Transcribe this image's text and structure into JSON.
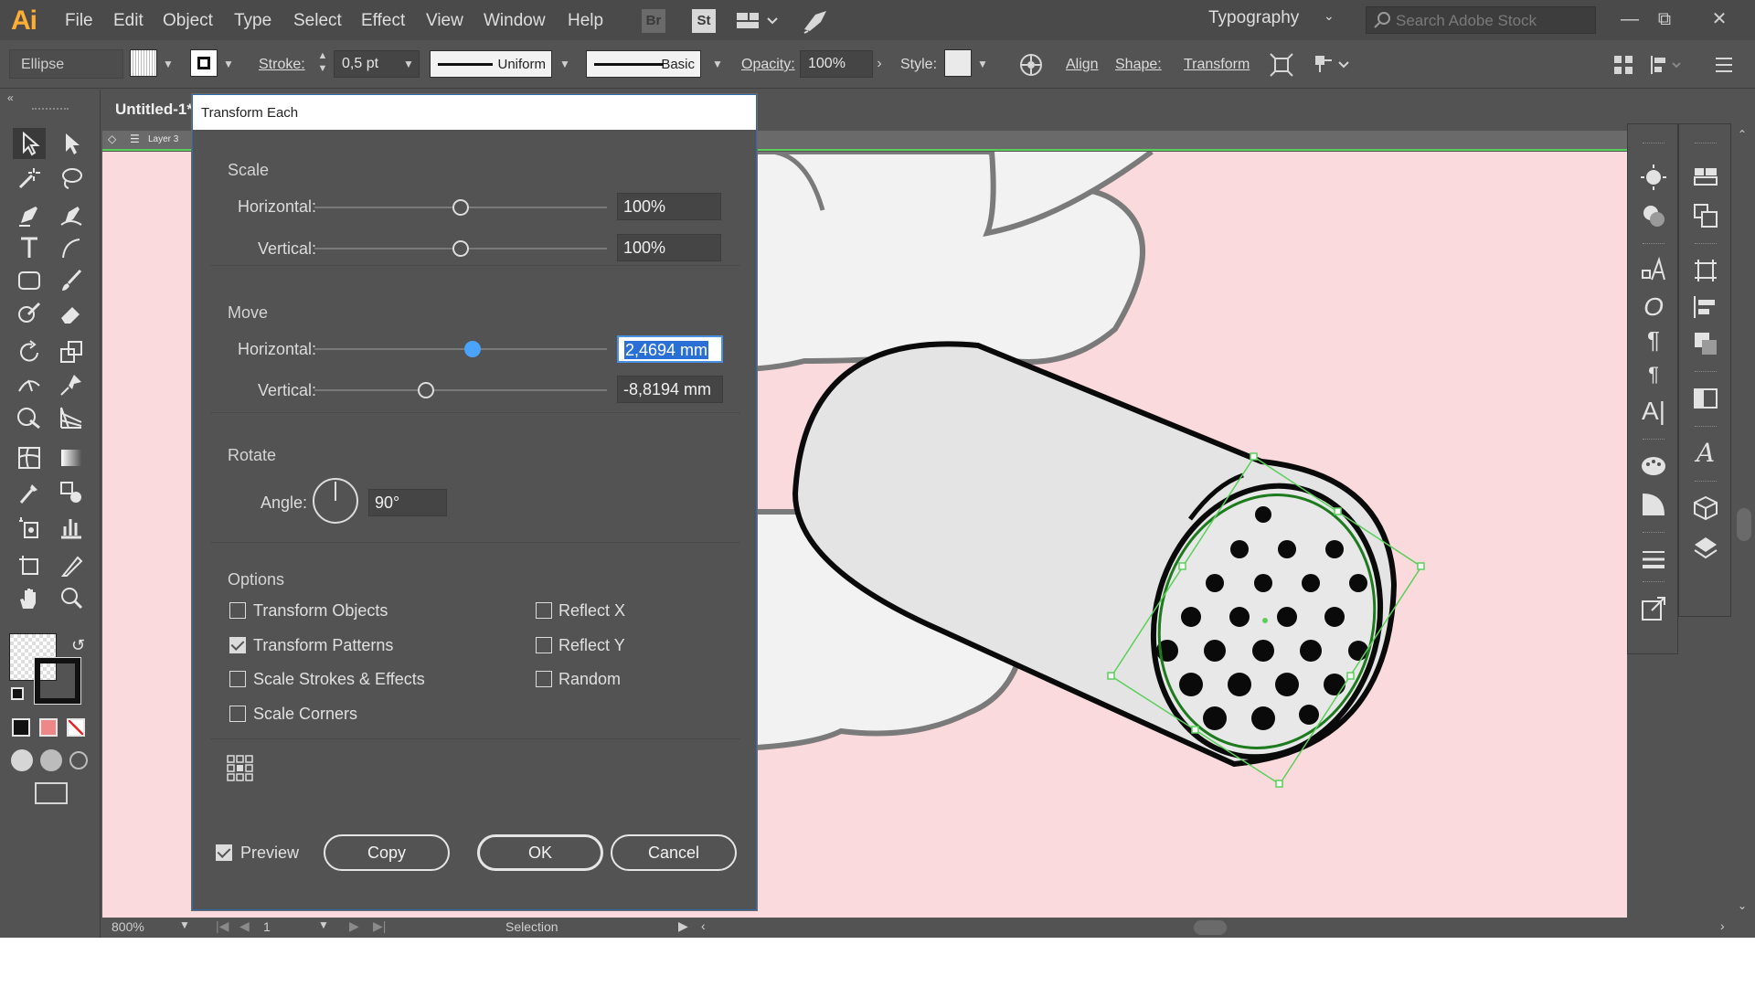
{
  "menu": {
    "app_logo": "Ai",
    "items": [
      "File",
      "Edit",
      "Object",
      "Type",
      "Select",
      "Effect",
      "View",
      "Window",
      "Help"
    ],
    "bridge": "Br",
    "stock": "St",
    "workspace": "Typography",
    "search_placeholder": "Search Adobe Stock"
  },
  "control_bar": {
    "object_type": "Ellipse",
    "stroke_label": "Stroke:",
    "stroke_weight": "0,5 pt",
    "profile_label": "Uniform",
    "brush_label": "Basic",
    "opacity_label": "Opacity:",
    "opacity_value": "100%",
    "style_label": "Style:",
    "align_label": "Align",
    "shape_label": "Shape:",
    "transform_label": "Transform"
  },
  "document": {
    "tab_title": "Untitled-1*",
    "layer_label": "Layer 3"
  },
  "status": {
    "zoom": "800%",
    "artboard": "1",
    "mode": "Selection"
  },
  "dialog": {
    "title": "Transform Each",
    "scale": {
      "title": "Scale",
      "horizontal_label": "Horizontal:",
      "horizontal_value": "100%",
      "horizontal_level": 0.5,
      "vertical_label": "Vertical:",
      "vertical_value": "100%",
      "vertical_level": 0.5
    },
    "move": {
      "title": "Move",
      "horizontal_label": "Horizontal:",
      "horizontal_value": "2,4694 mm",
      "horizontal_level": 0.54,
      "vertical_label": "Vertical:",
      "vertical_value": "-8,8194 mm",
      "vertical_level": 0.38
    },
    "rotate": {
      "title": "Rotate",
      "angle_label": "Angle:",
      "angle_value": "90°"
    },
    "options": {
      "title": "Options",
      "transform_objects": {
        "label": "Transform Objects",
        "checked": false
      },
      "transform_patterns": {
        "label": "Transform Patterns",
        "checked": true
      },
      "scale_strokes": {
        "label": "Scale Strokes & Effects",
        "checked": false
      },
      "scale_corners": {
        "label": "Scale Corners",
        "checked": false
      },
      "reflect_x": {
        "label": "Reflect X",
        "checked": false
      },
      "reflect_y": {
        "label": "Reflect Y",
        "checked": false
      },
      "random": {
        "label": "Random",
        "checked": false
      }
    },
    "preview": {
      "label": "Preview",
      "checked": true
    },
    "buttons": {
      "copy": "Copy",
      "ok": "OK",
      "cancel": "Cancel"
    }
  },
  "colors": {
    "canvas_bg": "#fadadd",
    "ui_bg": "#535353",
    "accent": "#4aa3ff",
    "selection": "#5ad05a"
  }
}
